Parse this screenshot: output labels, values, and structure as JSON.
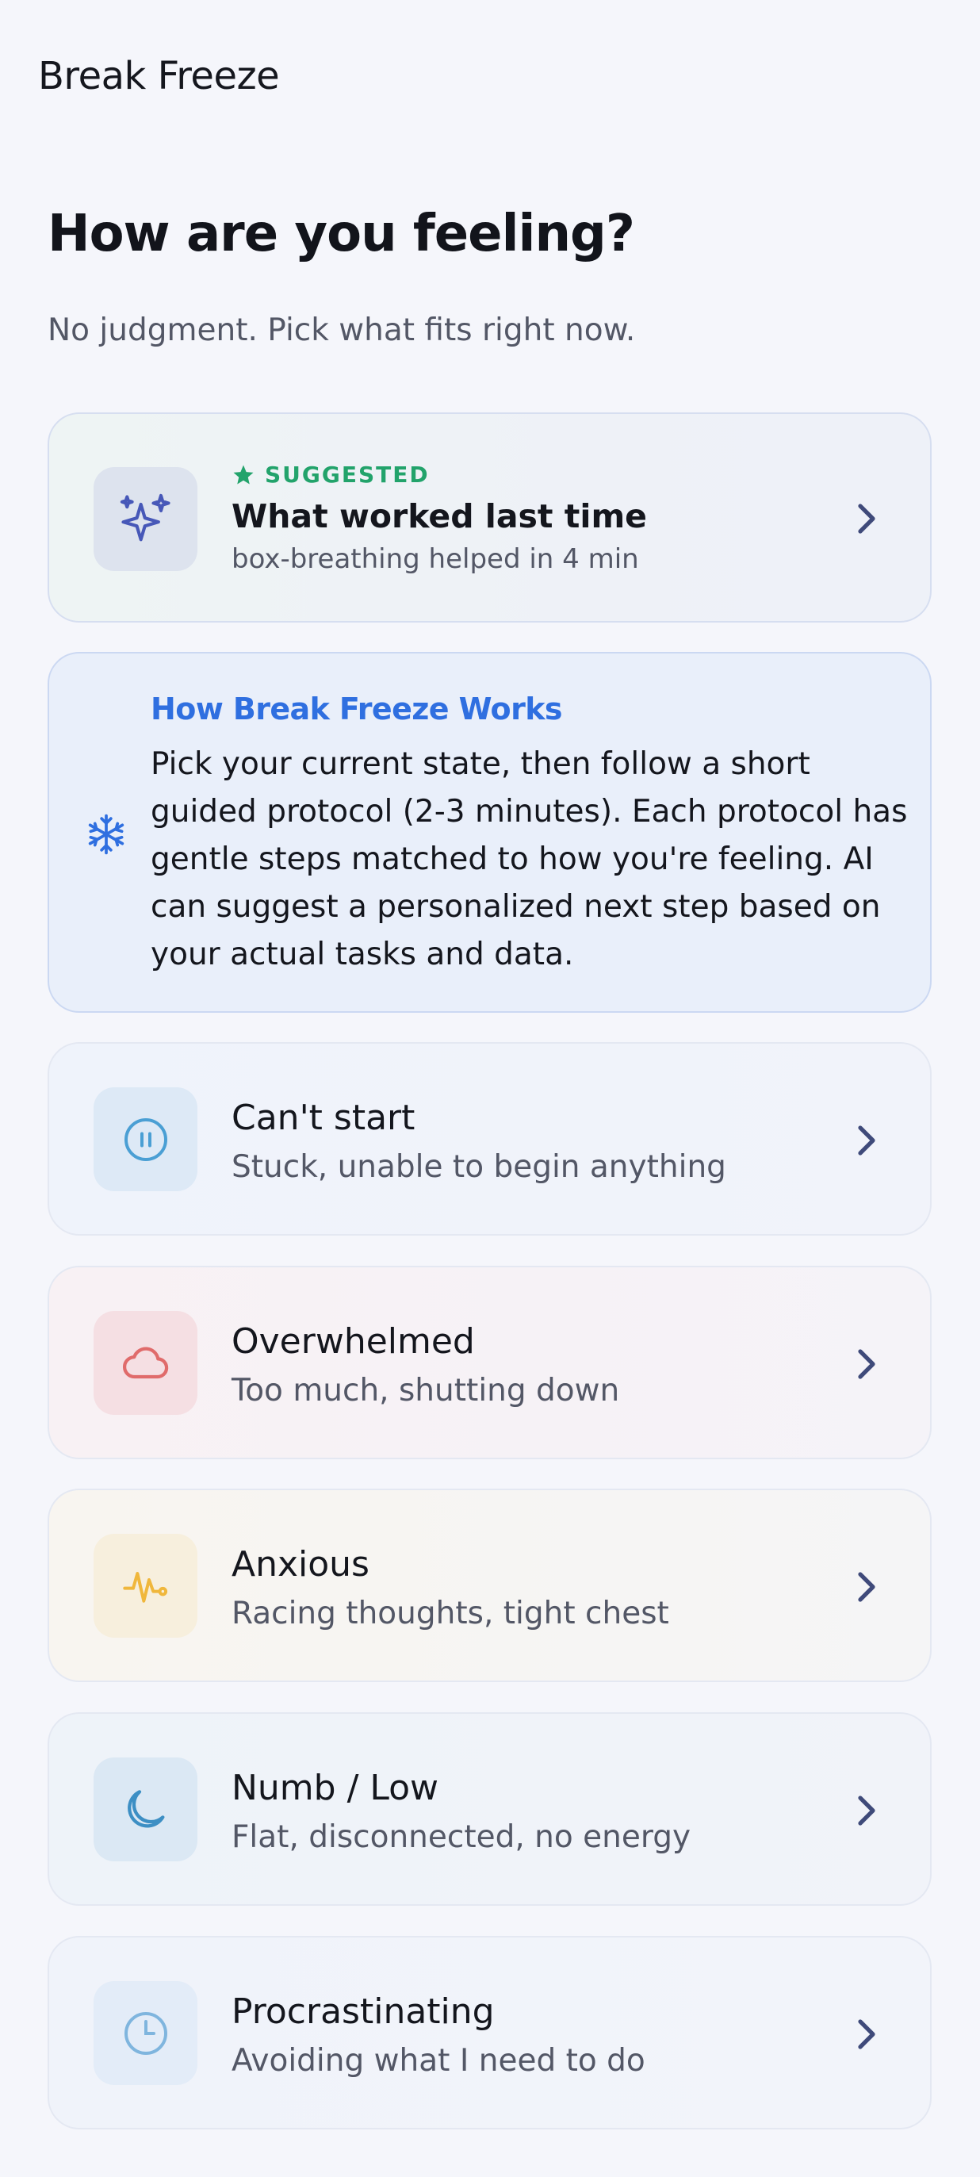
{
  "app": {
    "title": "Break Freeze"
  },
  "header": {
    "title": "How are you feeling?",
    "subtitle": "No judgment. Pick what fits right now."
  },
  "suggested": {
    "badge": "SUGGESTED",
    "title": "What worked last time",
    "subtitle": "box-breathing helped in 4 min",
    "icon": "sparkles-icon"
  },
  "info": {
    "title": "How Break Freeze Works",
    "body": "Pick your current state, then follow a short guided protocol (2-3 minutes). Each protocol has gentle steps matched to how you're feeling. AI can suggest a personalized next step based on your actual tasks and data.",
    "icon": "snowflake-icon"
  },
  "states": [
    {
      "title": "Can't start",
      "subtitle": "Stuck, unable to begin anything",
      "icon": "pause-icon",
      "color": "#4a9fd4"
    },
    {
      "title": "Overwhelmed",
      "subtitle": "Too much, shutting down",
      "icon": "cloud-icon",
      "color": "#e06b6b"
    },
    {
      "title": "Anxious",
      "subtitle": "Racing thoughts, tight chest",
      "icon": "pulse-icon",
      "color": "#f0b73c"
    },
    {
      "title": "Numb / Low",
      "subtitle": "Flat, disconnected, no energy",
      "icon": "moon-icon",
      "color": "#3d8fc4"
    },
    {
      "title": "Procrastinating",
      "subtitle": "Avoiding what I need to do",
      "icon": "clock-icon",
      "color": "#7fb5de"
    }
  ],
  "colors": {
    "accent_blue": "#2f6fe0",
    "suggested_green": "#22a36b",
    "chevron": "#3f4a7a",
    "sparkle": "#4758b8"
  }
}
